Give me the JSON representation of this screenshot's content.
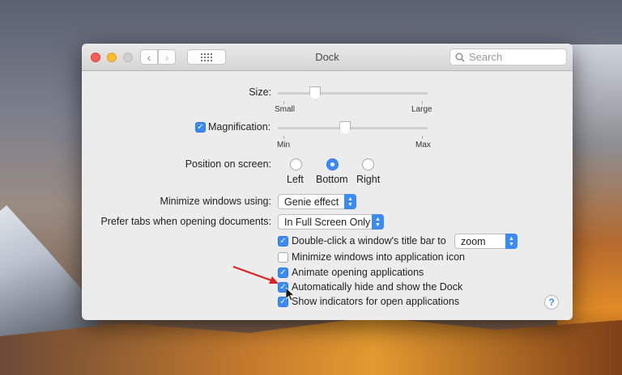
{
  "window": {
    "title": "Dock",
    "search_placeholder": "Search"
  },
  "size": {
    "label": "Size:",
    "min_label": "Small",
    "max_label": "Large",
    "value": 0.25
  },
  "magnification": {
    "label": "Magnification:",
    "checked": true,
    "min_label": "Min",
    "max_label": "Max",
    "value": 0.45
  },
  "position": {
    "label": "Position on screen:",
    "options": [
      "Left",
      "Bottom",
      "Right"
    ],
    "selected": "Bottom"
  },
  "minimize": {
    "label": "Minimize windows using:",
    "value": "Genie effect"
  },
  "prefer_tabs": {
    "label": "Prefer tabs when opening documents:",
    "value": "In Full Screen Only"
  },
  "options": [
    {
      "label": "Double-click a window's title bar to",
      "checked": true
    },
    {
      "label": "Minimize windows into application icon",
      "checked": false
    },
    {
      "label": "Animate opening applications",
      "checked": true
    },
    {
      "label": "Automatically hide and show the Dock",
      "checked": true
    },
    {
      "label": "Show indicators for open applications",
      "checked": true
    }
  ],
  "double_click_action": "zoom",
  "help_label": "?",
  "colors": {
    "accent": "#3a8bf5",
    "annotation_arrow": "#e02020"
  }
}
